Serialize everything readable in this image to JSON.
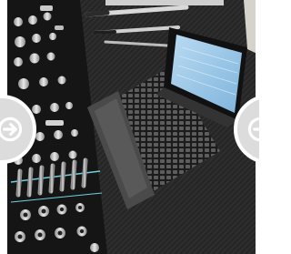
{
  "carousel": {
    "image": {
      "subject": "tool-organizer-and-laptop-photo"
    },
    "prev_button": {
      "icon": "arrow-right-icon"
    },
    "next_button": {
      "icon": "arrow-right-icon"
    }
  },
  "colors": {
    "mat": "#262626",
    "button_fill": "#dcdcdc",
    "button_ring": "#ffffff",
    "arrow": "#ffffff",
    "laptop_screen": "#9ec9e8",
    "accent_cyan": "#6fd0e0"
  }
}
